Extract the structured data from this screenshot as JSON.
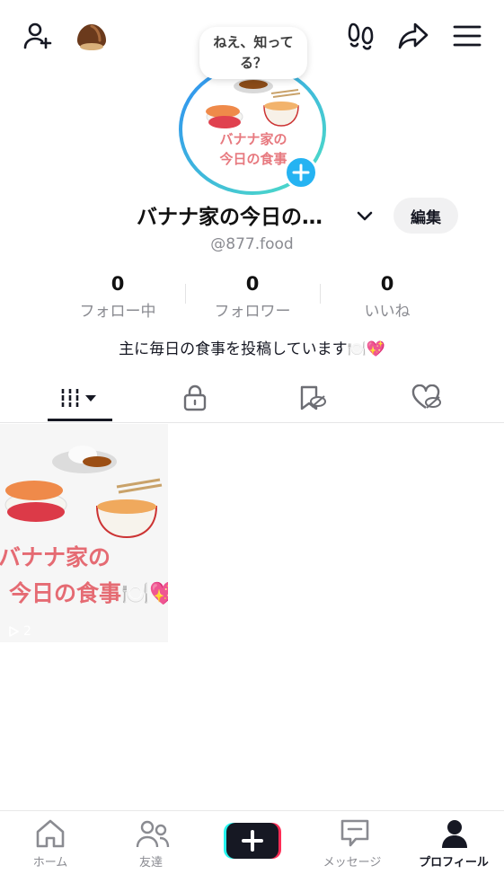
{
  "top_bar": {
    "add_friend_icon": "person-plus-icon",
    "chestnut_icon": "chestnut-icon",
    "footprints_icon": "footprints-icon",
    "share_icon": "share-arrow-icon",
    "menu_icon": "hamburger-menu-icon"
  },
  "profile": {
    "bubble_text_line1": "ねえ、知って",
    "bubble_text_line2": "る？",
    "avatar_text_line1": "バナナ家の",
    "avatar_text_line2": "今日の食事",
    "display_name": "バナナ家の今日の…",
    "edit_label": "編集",
    "handle": "@877.food",
    "bio": "主に毎日の食事を投稿しています🍽️💖"
  },
  "stats": [
    {
      "value": "0",
      "label": "フォロー中"
    },
    {
      "value": "0",
      "label": "フォロワー"
    },
    {
      "value": "0",
      "label": "いいね"
    }
  ],
  "tabs": [
    {
      "icon": "grid-icon",
      "active": true
    },
    {
      "icon": "lock-icon",
      "active": false
    },
    {
      "icon": "hidden-bookmark-icon",
      "active": false
    },
    {
      "icon": "hidden-heart-icon",
      "active": false
    }
  ],
  "videos": [
    {
      "text_line1": "バナナ家の",
      "text_line2": "今日の食事🍽️💖",
      "views": "2"
    }
  ],
  "bottom_nav": [
    {
      "label": "ホーム",
      "icon": "home-icon"
    },
    {
      "label": "友達",
      "icon": "friends-icon"
    },
    {
      "label": "",
      "icon": "plus-icon"
    },
    {
      "label": "メッセージ",
      "icon": "message-icon"
    },
    {
      "label": "プロフィール",
      "icon": "profile-icon"
    }
  ],
  "colors": {
    "accent_blue": "#25b3f2",
    "ring_teal": "#4fd8c4",
    "food_pink": "#e7797f",
    "create_cyan": "#25f4ee",
    "create_red": "#fe2c55"
  }
}
